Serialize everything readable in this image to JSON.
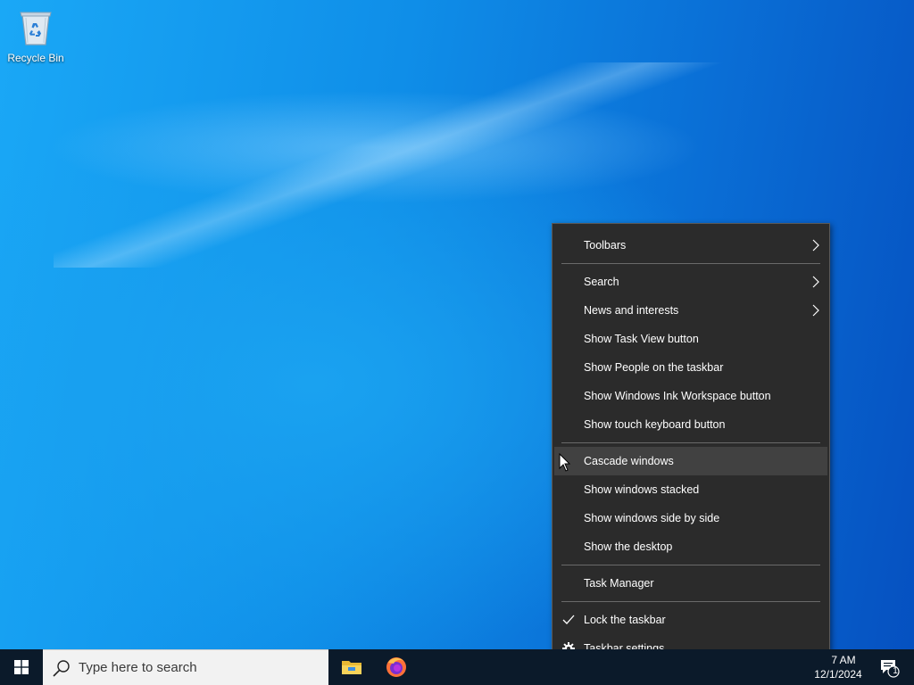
{
  "desktop": {
    "icons": [
      {
        "label": "Recycle Bin",
        "icon": "recycle-bin-icon"
      }
    ]
  },
  "context_menu": {
    "items": [
      {
        "label": "Toolbars",
        "submenu": true
      },
      {
        "label": "Search",
        "submenu": true
      },
      {
        "label": "News and interests",
        "submenu": true
      },
      {
        "label": "Show Task View button"
      },
      {
        "label": "Show People on the taskbar"
      },
      {
        "label": "Show Windows Ink Workspace button"
      },
      {
        "label": "Show touch keyboard button"
      },
      {
        "label": "Cascade windows",
        "hovered": true
      },
      {
        "label": "Show windows stacked"
      },
      {
        "label": "Show windows side by side"
      },
      {
        "label": "Show the desktop"
      },
      {
        "label": "Task Manager"
      },
      {
        "label": "Lock the taskbar",
        "checked": true,
        "icon": "checkmark-icon"
      },
      {
        "label": "Taskbar settings",
        "icon": "gear-icon"
      }
    ]
  },
  "taskbar": {
    "search_placeholder": "Type here to search",
    "pinned_apps": [
      {
        "name": "File Explorer",
        "icon": "file-explorer-icon"
      },
      {
        "name": "Firefox",
        "icon": "firefox-icon"
      }
    ],
    "clock": {
      "time": "7 AM",
      "date": "12/1/2024"
    },
    "notification_count": "1"
  },
  "colors": {
    "menu_bg": "#2b2b2b",
    "menu_hover": "#414141",
    "taskbar_bg": "#0b1a2a",
    "desktop_accent": "#0a6fd6"
  }
}
